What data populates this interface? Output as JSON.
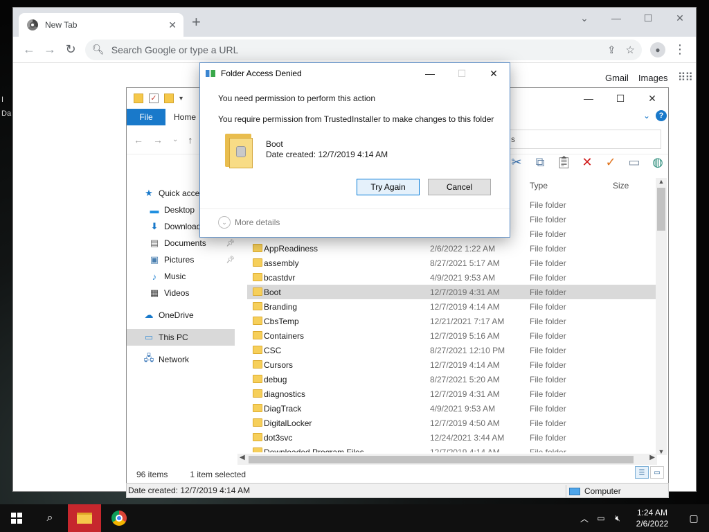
{
  "browser": {
    "tab_title": "New Tab",
    "omnibox_placeholder": "Search Google or type a URL",
    "links": {
      "gmail": "Gmail",
      "images": "Images"
    }
  },
  "desktop": {
    "hint_1": "I",
    "hint_2": "Da"
  },
  "explorer": {
    "ribbon_tabs": {
      "file": "File",
      "home": "Home"
    },
    "address_tail": "s",
    "nav_items": [
      {
        "label": "Quick access",
        "icon": "star-icon"
      },
      {
        "label": "Desktop",
        "icon": "desktop-icon",
        "pinned": true
      },
      {
        "label": "Downloads",
        "icon": "download-icon",
        "pinned": true
      },
      {
        "label": "Documents",
        "icon": "documents-icon",
        "pinned": true
      },
      {
        "label": "Pictures",
        "icon": "pictures-icon",
        "pinned": true
      },
      {
        "label": "Music",
        "icon": "music-icon"
      },
      {
        "label": "Videos",
        "icon": "videos-icon"
      },
      {
        "label": "OneDrive",
        "icon": "onedrive-icon"
      },
      {
        "label": "This PC",
        "icon": "this-pc-icon",
        "selected": true
      },
      {
        "label": "Network",
        "icon": "network-icon"
      }
    ],
    "columns": {
      "type": "Type",
      "size": "Size"
    },
    "files": [
      {
        "name": "",
        "date": "",
        "type": "File folder"
      },
      {
        "name": "",
        "date": "",
        "type": "File folder"
      },
      {
        "name": "",
        "date": "",
        "type": "File folder"
      },
      {
        "name": "AppReadiness",
        "date": "2/6/2022 1:22 AM",
        "type": "File folder"
      },
      {
        "name": "assembly",
        "date": "8/27/2021 5:17 AM",
        "type": "File folder"
      },
      {
        "name": "bcastdvr",
        "date": "4/9/2021 9:53 AM",
        "type": "File folder"
      },
      {
        "name": "Boot",
        "date": "12/7/2019 4:31 AM",
        "type": "File folder",
        "selected": true
      },
      {
        "name": "Branding",
        "date": "12/7/2019 4:14 AM",
        "type": "File folder"
      },
      {
        "name": "CbsTemp",
        "date": "12/21/2021 7:17 AM",
        "type": "File folder"
      },
      {
        "name": "Containers",
        "date": "12/7/2019 5:16 AM",
        "type": "File folder"
      },
      {
        "name": "CSC",
        "date": "8/27/2021 12:10 PM",
        "type": "File folder"
      },
      {
        "name": "Cursors",
        "date": "12/7/2019 4:14 AM",
        "type": "File folder"
      },
      {
        "name": "debug",
        "date": "8/27/2021 5:20 AM",
        "type": "File folder"
      },
      {
        "name": "diagnostics",
        "date": "12/7/2019 4:31 AM",
        "type": "File folder"
      },
      {
        "name": "DiagTrack",
        "date": "4/9/2021 9:53 AM",
        "type": "File folder"
      },
      {
        "name": "DigitalLocker",
        "date": "12/7/2019 4:50 AM",
        "type": "File folder"
      },
      {
        "name": "dot3svc",
        "date": "12/24/2021 3:44 AM",
        "type": "File folder"
      },
      {
        "name": "Downloaded Program Files",
        "date": "12/7/2019 4:14 AM",
        "type": "File folder"
      }
    ],
    "status": {
      "items": "96 items",
      "selected": "1 item selected"
    },
    "details_strip": {
      "date_created": "Date created: 12/7/2019 4:14 AM",
      "location": "Computer"
    }
  },
  "dialog": {
    "title": "Folder Access Denied",
    "heading": "You need permission to perform this action",
    "message": "You require permission from TrustedInstaller to make changes to this folder",
    "folder_name": "Boot",
    "folder_date": "Date created: 12/7/2019 4:14 AM",
    "try_again": "Try Again",
    "cancel": "Cancel",
    "more_details": "More details"
  },
  "taskbar": {
    "time": "1:24 AM",
    "date": "2/6/2022"
  }
}
